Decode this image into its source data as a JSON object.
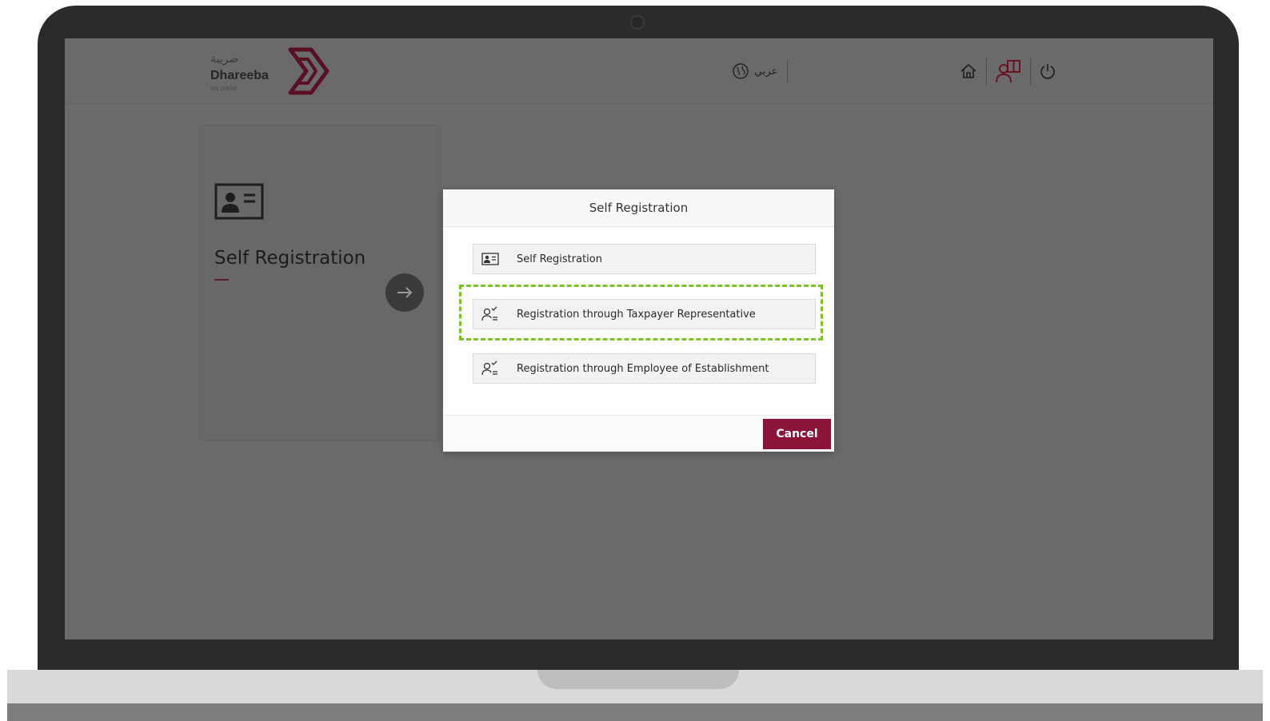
{
  "header": {
    "logo": {
      "arabic_name": "ضريبة",
      "english_name": "Dhareeba",
      "tagline": "tax portal",
      "brand_color": "#8a1538"
    },
    "language_toggle": {
      "label": "عربي",
      "icon": "globe-icon"
    },
    "actions": [
      {
        "name": "home",
        "icon": "home-icon"
      },
      {
        "name": "user-guide",
        "icon": "user-book-icon"
      },
      {
        "name": "logout",
        "icon": "power-icon"
      }
    ]
  },
  "background_card": {
    "title": "Self Registration",
    "icon": "id-card-icon",
    "action_icon": "arrow-right-icon"
  },
  "modal": {
    "title": "Self Registration",
    "options": [
      {
        "label": "Self Registration",
        "icon": "id-card-icon"
      },
      {
        "label": "Registration through Taxpayer Representative",
        "icon": "user-check-icon",
        "highlighted": true
      },
      {
        "label": "Registration through Employee of Establishment",
        "icon": "user-check-icon"
      }
    ],
    "cancel_label": "Cancel",
    "highlight_color": "#7ec225"
  }
}
